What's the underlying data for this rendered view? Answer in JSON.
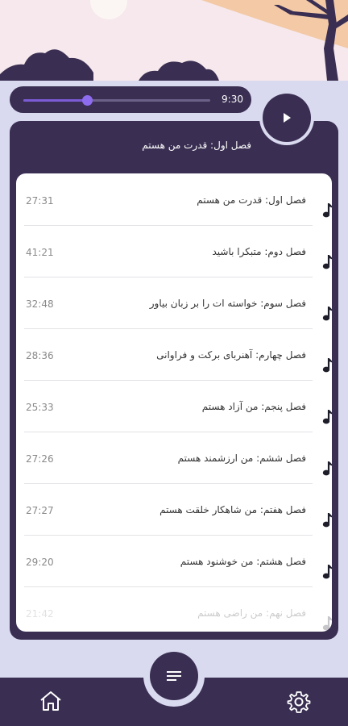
{
  "player": {
    "time": "9:30",
    "progress": 0.34
  },
  "now_playing": {
    "title": "فصل اول: قدرت من هستم"
  },
  "chapters": [
    {
      "title": "فصل اول: قدرت من هستم",
      "duration": "27:31"
    },
    {
      "title": "فصل دوم: متبکرا باشید",
      "duration": "41:21"
    },
    {
      "title": "فصل سوم: خواسته ات را بر زبان بیاور",
      "duration": "32:48"
    },
    {
      "title": "فصل چهارم: آهنربای برکت و فراوانی",
      "duration": "28:36"
    },
    {
      "title": "فصل پنجم: من آزاد هستم",
      "duration": "25:33"
    },
    {
      "title": "فصل ششم: من ارزشمند هستم",
      "duration": "27:26"
    },
    {
      "title": "فصل هفتم: من شاهکار خلقت هستم",
      "duration": "27:27"
    },
    {
      "title": "فصل هشتم: من خوشنود هستم",
      "duration": "29:20"
    },
    {
      "title": "فصل نهم: من راضی هستم",
      "duration": "21:42"
    }
  ],
  "icons": {
    "play": "play-icon",
    "menu": "menu-icon",
    "home": "home-icon",
    "settings": "gear-icon",
    "track": "music-note-icon"
  },
  "colors": {
    "primary": "#3a2f52",
    "accent": "#7b5bd6",
    "background": "#d9d9ef"
  }
}
